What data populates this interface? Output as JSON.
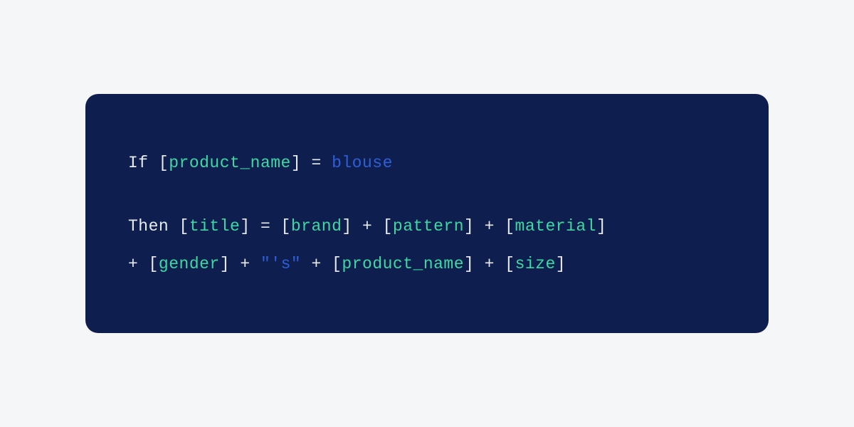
{
  "code": {
    "line1": {
      "t1": "If [",
      "v1": "product_name",
      "t2": "] = ",
      "v2": "blouse"
    },
    "line2": {
      "t1": "Then [",
      "v1": "title",
      "t2": "] = [",
      "v2": "brand",
      "t3": "] + [",
      "v3": "pattern",
      "t4": "] + [",
      "v4": "material",
      "t5": "]"
    },
    "line3": {
      "t1": "+ [",
      "v1": "gender",
      "t2": "] + ",
      "lit": "\"'s\"",
      "t3": " + [",
      "v2": "product_name",
      "t4": "] + [",
      "v3": "size",
      "t5": "]"
    }
  }
}
